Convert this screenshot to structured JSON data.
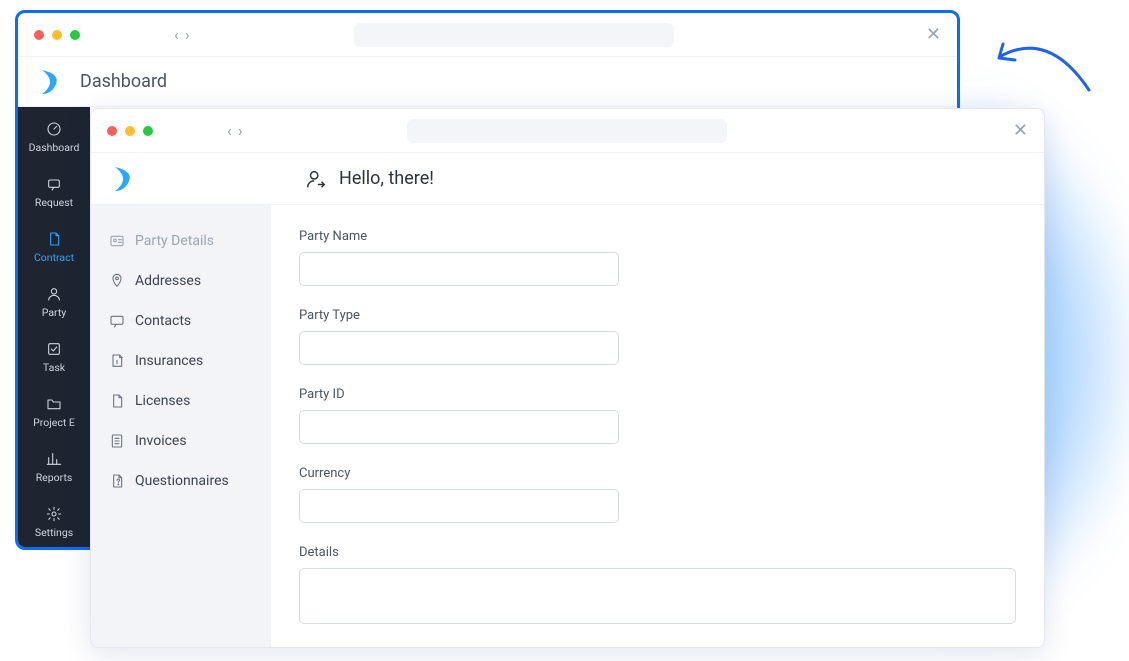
{
  "back_window": {
    "app_title": "Dashboard",
    "sidebar": [
      {
        "key": "dashboard",
        "label": "Dashboard",
        "active": false,
        "icon": "gauge-icon"
      },
      {
        "key": "request",
        "label": "Request",
        "active": false,
        "icon": "message-icon"
      },
      {
        "key": "contract",
        "label": "Contract",
        "active": true,
        "icon": "document-icon"
      },
      {
        "key": "party",
        "label": "Party",
        "active": false,
        "icon": "user-icon"
      },
      {
        "key": "task",
        "label": "Task",
        "active": false,
        "icon": "check-icon"
      },
      {
        "key": "project",
        "label": "Project E",
        "active": false,
        "icon": "folder-icon"
      },
      {
        "key": "reports",
        "label": "Reports",
        "active": false,
        "icon": "chart-icon"
      },
      {
        "key": "settings",
        "label": "Settings",
        "active": false,
        "icon": "gear-icon"
      }
    ]
  },
  "front_window": {
    "greeting": "Hello, there!",
    "sidebar": [
      {
        "key": "party-details",
        "label": "Party Details",
        "selected": true,
        "icon": "id-card-icon"
      },
      {
        "key": "addresses",
        "label": "Addresses",
        "selected": false,
        "icon": "pin-icon"
      },
      {
        "key": "contacts",
        "label": "Contacts",
        "selected": false,
        "icon": "chat-icon"
      },
      {
        "key": "insurances",
        "label": "Insurances",
        "selected": false,
        "icon": "shield-icon"
      },
      {
        "key": "licenses",
        "label": "Licenses",
        "selected": false,
        "icon": "file-icon"
      },
      {
        "key": "invoices",
        "label": "Invoices",
        "selected": false,
        "icon": "invoice-icon"
      },
      {
        "key": "questionnaires",
        "label": "Questionnaires",
        "selected": false,
        "icon": "question-icon"
      }
    ],
    "form": {
      "fields": [
        {
          "key": "party_name",
          "label": "Party Name",
          "type": "text",
          "value": ""
        },
        {
          "key": "party_type",
          "label": "Party Type",
          "type": "text",
          "value": ""
        },
        {
          "key": "party_id",
          "label": "Party ID",
          "type": "text",
          "value": ""
        },
        {
          "key": "currency",
          "label": "Currency",
          "type": "text",
          "value": ""
        },
        {
          "key": "details",
          "label": "Details",
          "type": "textarea",
          "value": ""
        }
      ]
    }
  }
}
